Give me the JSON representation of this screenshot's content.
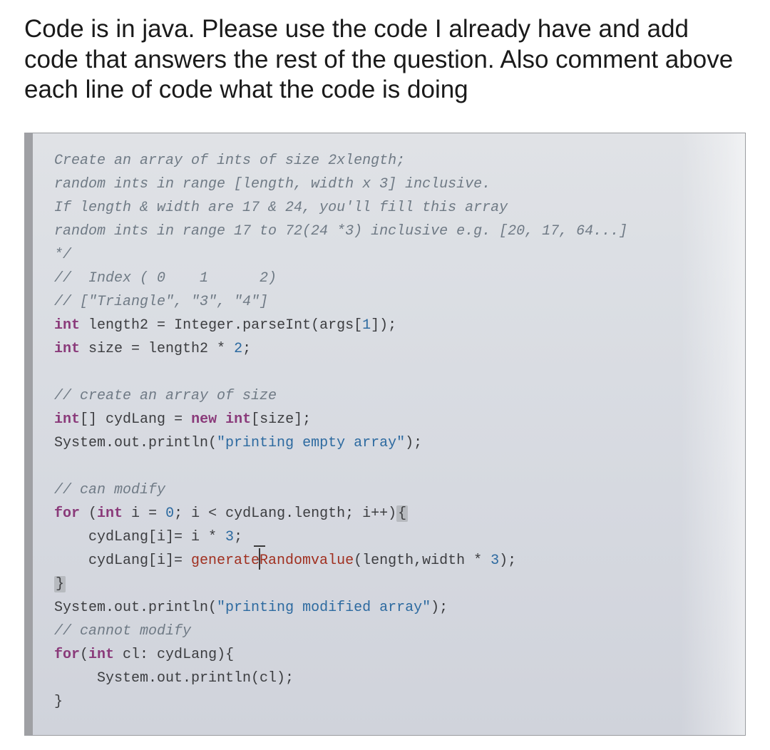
{
  "question": "Code is in java. Please use the code I already have and add code that answers the rest of the question. Also comment above each line of code what the code is doing",
  "code": {
    "l1": "Create an array of ints of size 2xlength;",
    "l2": "random ints in range [length, width x 3] inclusive.",
    "l3": "If length & width are 17 & 24, you'll fill this array",
    "l4": "random ints in range 17 to 72(24 *3) inclusive e.g. [20, 17, 64...]",
    "l5": "*/",
    "l6a": "//  Index ( 0    1      2)",
    "l7a": "// [\"Triangle\", \"3\", \"4\"]",
    "l8_kw_int": "int",
    "l8_id": " length2 ",
    "l8_eq": "=",
    "l8_call": " Integer.parseInt(args[",
    "l8_num": "1",
    "l8_end": "]);",
    "l9_kw_int": "int",
    "l9_rest": " size = length2 * ",
    "l9_num": "2",
    "l9_semi": ";",
    "l10": "// create an array of size",
    "l11_kw_int": "int",
    "l11_brackets": "[]",
    "l11_id": " cydLang ",
    "l11_eq": "=",
    "l11_new": " new ",
    "l11_int2": "int",
    "l11_size": "[size];",
    "l12_sys": "System.out.println(",
    "l12_str": "\"printing empty array\"",
    "l12_end": ");",
    "l13": "// can modify",
    "l14_for": "for",
    "l14_open": " (",
    "l14_int": "int",
    "l14_i": " i ",
    "l14_eq": "= ",
    "l14_zero": "0",
    "l14_cond": "; i < cydLang.length; i++)",
    "l14_brace": "{",
    "l15_assign": "    cydLang[i]= i * ",
    "l15_three": "3",
    "l15_semi": ";",
    "l16_lhs": "    cydLang[i]= ",
    "l16_fn": "generate",
    "l16_fnR": "Randomvalue",
    "l16_args": "(length,width * ",
    "l16_three": "3",
    "l16_end": ");",
    "l17_brace": "}",
    "l18_sys": "System.out.println(",
    "l18_str": "\"printing modified array\"",
    "l18_end": ");",
    "l19": "// cannot modify",
    "l20_for": "for",
    "l20_open": "(",
    "l20_int": "int",
    "l20_rest": " cl: cydLang){",
    "l21": "     System.out.println(cl);",
    "l22_brace": "}"
  }
}
